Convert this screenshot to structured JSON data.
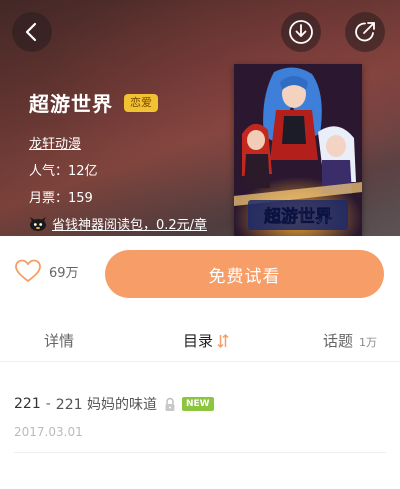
{
  "header": {
    "back_icon": "chevron-left-icon",
    "download_icon": "download-icon",
    "share_icon": "share-icon"
  },
  "comic": {
    "title": "超游世界",
    "genre_tag": "恋爱",
    "author": "龙轩动漫",
    "popularity": "人气：12亿",
    "monthly_votes": "月票：159",
    "promo": "省钱神器阅读包，0.2元/章",
    "cover_title_art": "超游世界"
  },
  "actions": {
    "like_count": "69万",
    "read_button": "免费试看"
  },
  "tabs": {
    "detail": "详情",
    "catalog": "目录",
    "topic": "话题",
    "topic_count": "1万"
  },
  "chapters": [
    {
      "number": "221",
      "separator": "-",
      "title": "221 妈妈的味道",
      "badge": "NEW",
      "date": "2017.03.01"
    }
  ],
  "colors": {
    "accent_orange": "#f79e68",
    "tag_yellow": "#f1c232",
    "new_green": "#8cc63f"
  }
}
